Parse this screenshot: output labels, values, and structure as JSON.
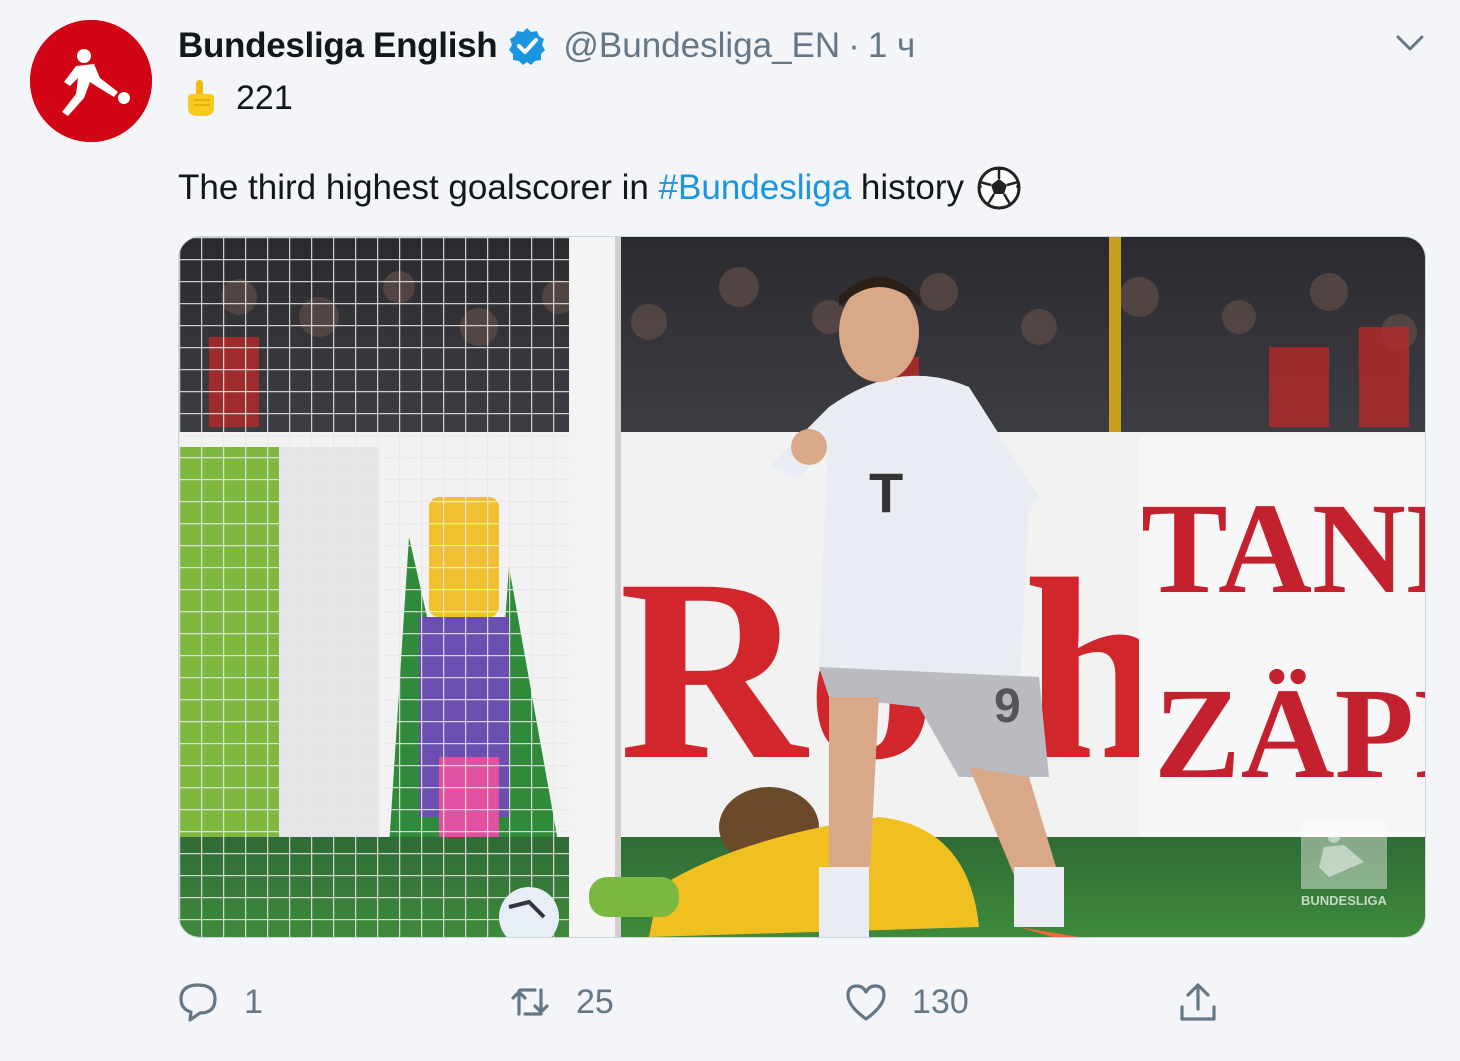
{
  "tweet": {
    "display_name": "Bundesliga English",
    "handle": "@Bundesliga_EN",
    "separator": "·",
    "time": "1 ч",
    "subline_count": "221",
    "text_before": "The third highest goalscorer in ",
    "hashtag": "#Bundesliga",
    "text_after": " history",
    "media": {
      "description_icon": "photo",
      "ad_board_left": "Rothaus",
      "ad_board_right_top": "TANNE",
      "ad_board_right_bottom": "ZÄPFL",
      "shirt_sponsor": "T",
      "shirt_number": "9",
      "watermark": "BUNDESLIGA"
    }
  },
  "actions": {
    "reply_count": "1",
    "retweet_count": "25",
    "like_count": "130"
  },
  "icons": {
    "avatar": "bundesliga-logo-icon",
    "verified": "verified-badge-icon",
    "more": "chevron-down-icon",
    "pointer": "pointing-finger-icon",
    "ball": "soccer-ball-icon",
    "reply": "reply-icon",
    "retweet": "retweet-icon",
    "like": "heart-icon",
    "share": "share-icon"
  },
  "colors": {
    "accent": "#1b95e0",
    "brand_red": "#d20515",
    "muted": "#657786",
    "background": "#f3f5f8"
  }
}
